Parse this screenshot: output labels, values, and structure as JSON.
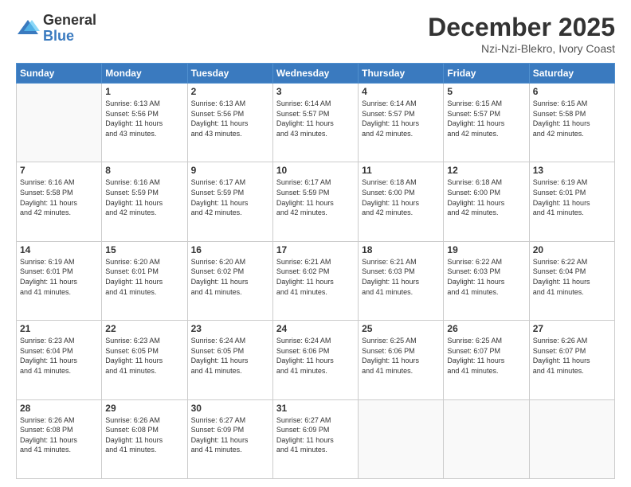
{
  "logo": {
    "general": "General",
    "blue": "Blue"
  },
  "header": {
    "month": "December 2025",
    "location": "Nzi-Nzi-Blekro, Ivory Coast"
  },
  "weekdays": [
    "Sunday",
    "Monday",
    "Tuesday",
    "Wednesday",
    "Thursday",
    "Friday",
    "Saturday"
  ],
  "weeks": [
    [
      {
        "day": "",
        "info": ""
      },
      {
        "day": "1",
        "info": "Sunrise: 6:13 AM\nSunset: 5:56 PM\nDaylight: 11 hours\nand 43 minutes."
      },
      {
        "day": "2",
        "info": "Sunrise: 6:13 AM\nSunset: 5:56 PM\nDaylight: 11 hours\nand 43 minutes."
      },
      {
        "day": "3",
        "info": "Sunrise: 6:14 AM\nSunset: 5:57 PM\nDaylight: 11 hours\nand 43 minutes."
      },
      {
        "day": "4",
        "info": "Sunrise: 6:14 AM\nSunset: 5:57 PM\nDaylight: 11 hours\nand 42 minutes."
      },
      {
        "day": "5",
        "info": "Sunrise: 6:15 AM\nSunset: 5:57 PM\nDaylight: 11 hours\nand 42 minutes."
      },
      {
        "day": "6",
        "info": "Sunrise: 6:15 AM\nSunset: 5:58 PM\nDaylight: 11 hours\nand 42 minutes."
      }
    ],
    [
      {
        "day": "7",
        "info": "Sunrise: 6:16 AM\nSunset: 5:58 PM\nDaylight: 11 hours\nand 42 minutes."
      },
      {
        "day": "8",
        "info": "Sunrise: 6:16 AM\nSunset: 5:59 PM\nDaylight: 11 hours\nand 42 minutes."
      },
      {
        "day": "9",
        "info": "Sunrise: 6:17 AM\nSunset: 5:59 PM\nDaylight: 11 hours\nand 42 minutes."
      },
      {
        "day": "10",
        "info": "Sunrise: 6:17 AM\nSunset: 5:59 PM\nDaylight: 11 hours\nand 42 minutes."
      },
      {
        "day": "11",
        "info": "Sunrise: 6:18 AM\nSunset: 6:00 PM\nDaylight: 11 hours\nand 42 minutes."
      },
      {
        "day": "12",
        "info": "Sunrise: 6:18 AM\nSunset: 6:00 PM\nDaylight: 11 hours\nand 42 minutes."
      },
      {
        "day": "13",
        "info": "Sunrise: 6:19 AM\nSunset: 6:01 PM\nDaylight: 11 hours\nand 41 minutes."
      }
    ],
    [
      {
        "day": "14",
        "info": "Sunrise: 6:19 AM\nSunset: 6:01 PM\nDaylight: 11 hours\nand 41 minutes."
      },
      {
        "day": "15",
        "info": "Sunrise: 6:20 AM\nSunset: 6:01 PM\nDaylight: 11 hours\nand 41 minutes."
      },
      {
        "day": "16",
        "info": "Sunrise: 6:20 AM\nSunset: 6:02 PM\nDaylight: 11 hours\nand 41 minutes."
      },
      {
        "day": "17",
        "info": "Sunrise: 6:21 AM\nSunset: 6:02 PM\nDaylight: 11 hours\nand 41 minutes."
      },
      {
        "day": "18",
        "info": "Sunrise: 6:21 AM\nSunset: 6:03 PM\nDaylight: 11 hours\nand 41 minutes."
      },
      {
        "day": "19",
        "info": "Sunrise: 6:22 AM\nSunset: 6:03 PM\nDaylight: 11 hours\nand 41 minutes."
      },
      {
        "day": "20",
        "info": "Sunrise: 6:22 AM\nSunset: 6:04 PM\nDaylight: 11 hours\nand 41 minutes."
      }
    ],
    [
      {
        "day": "21",
        "info": "Sunrise: 6:23 AM\nSunset: 6:04 PM\nDaylight: 11 hours\nand 41 minutes."
      },
      {
        "day": "22",
        "info": "Sunrise: 6:23 AM\nSunset: 6:05 PM\nDaylight: 11 hours\nand 41 minutes."
      },
      {
        "day": "23",
        "info": "Sunrise: 6:24 AM\nSunset: 6:05 PM\nDaylight: 11 hours\nand 41 minutes."
      },
      {
        "day": "24",
        "info": "Sunrise: 6:24 AM\nSunset: 6:06 PM\nDaylight: 11 hours\nand 41 minutes."
      },
      {
        "day": "25",
        "info": "Sunrise: 6:25 AM\nSunset: 6:06 PM\nDaylight: 11 hours\nand 41 minutes."
      },
      {
        "day": "26",
        "info": "Sunrise: 6:25 AM\nSunset: 6:07 PM\nDaylight: 11 hours\nand 41 minutes."
      },
      {
        "day": "27",
        "info": "Sunrise: 6:26 AM\nSunset: 6:07 PM\nDaylight: 11 hours\nand 41 minutes."
      }
    ],
    [
      {
        "day": "28",
        "info": "Sunrise: 6:26 AM\nSunset: 6:08 PM\nDaylight: 11 hours\nand 41 minutes."
      },
      {
        "day": "29",
        "info": "Sunrise: 6:26 AM\nSunset: 6:08 PM\nDaylight: 11 hours\nand 41 minutes."
      },
      {
        "day": "30",
        "info": "Sunrise: 6:27 AM\nSunset: 6:09 PM\nDaylight: 11 hours\nand 41 minutes."
      },
      {
        "day": "31",
        "info": "Sunrise: 6:27 AM\nSunset: 6:09 PM\nDaylight: 11 hours\nand 41 minutes."
      },
      {
        "day": "",
        "info": ""
      },
      {
        "day": "",
        "info": ""
      },
      {
        "day": "",
        "info": ""
      }
    ]
  ]
}
